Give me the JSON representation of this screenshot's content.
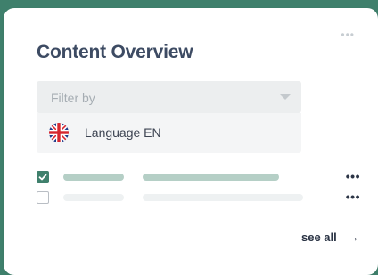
{
  "colors": {
    "background": "#3f806c",
    "card": "#ffffff",
    "title": "#3d4b63",
    "accent": "#3f806c",
    "skeleton_dark": "#b5cfc6",
    "skeleton_light": "#eef1f2"
  },
  "card": {
    "menu_icon": "more-horizontal-icon",
    "menu_glyph": "•••",
    "title": "Content Overview"
  },
  "filter": {
    "placeholder": "Filter by",
    "caret_icon": "chevron-down-icon",
    "selected_option": {
      "flag_icon": "uk-flag-icon",
      "label": "Language EN"
    }
  },
  "rows": [
    {
      "checked": true,
      "more_glyph": "•••"
    },
    {
      "checked": false,
      "more_glyph": "•••"
    }
  ],
  "footer": {
    "see_all_label": "see all",
    "arrow_glyph": "→"
  }
}
